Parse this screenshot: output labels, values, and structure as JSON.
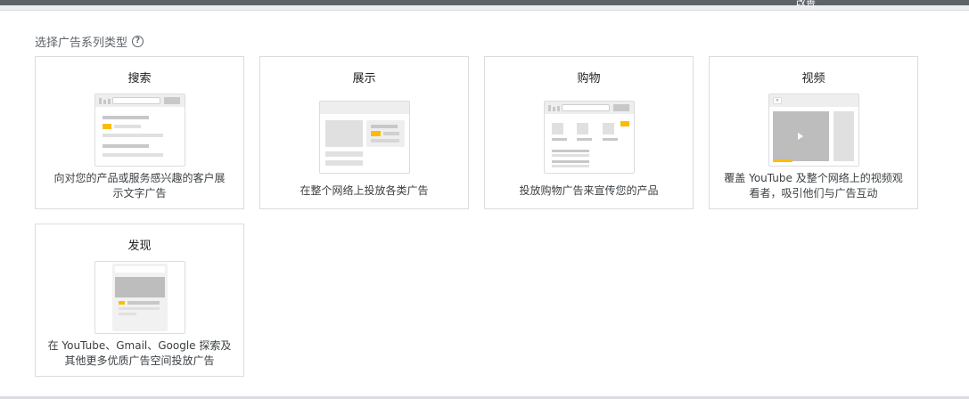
{
  "header": {
    "stray_text": "改善"
  },
  "section": {
    "title": "选择广告系列类型",
    "help_icon": "help-circle-icon"
  },
  "cards": [
    {
      "key": "search",
      "title": "搜索",
      "desc_lines": [
        "向对您的产品或服务感兴趣的客户展",
        "示文字广告"
      ]
    },
    {
      "key": "display",
      "title": "展示",
      "desc_lines": [
        "在整个网络上投放各类广告"
      ]
    },
    {
      "key": "shopping",
      "title": "购物",
      "desc_lines": [
        "投放购物广告来宣传您的产品"
      ]
    },
    {
      "key": "video",
      "title": "视频",
      "desc_lines": [
        "覆盖 YouTube 及整个网络上的视频观",
        "看者，吸引他们与广告互动"
      ]
    },
    {
      "key": "discovery",
      "title": "发现",
      "desc_lines": [
        "在 YouTube、Gmail、Google 探索及",
        "其他更多优质广告空间投放广告"
      ]
    }
  ],
  "colors": {
    "accent_yellow": "#fbbc04",
    "border": "#dadce0",
    "text_primary": "#202124",
    "text_secondary": "#5f6368"
  }
}
